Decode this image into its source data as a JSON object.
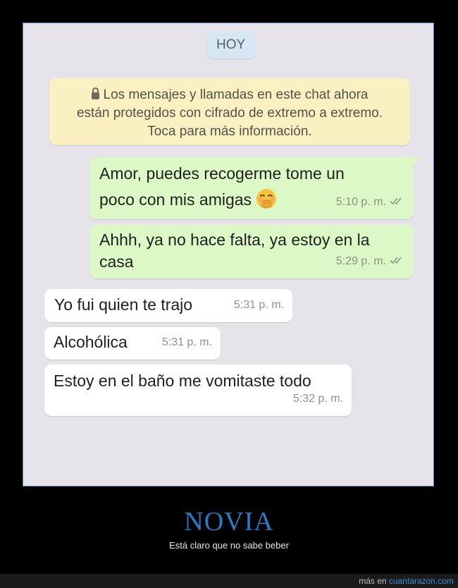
{
  "chat": {
    "date_label": "HOY",
    "encryption_notice": {
      "line1": "Los mensajes y llamadas en este chat ahora",
      "line2": "están protegidos con cifrado de extremo a extremo.",
      "line3": "Toca para más información."
    },
    "messages": [
      {
        "direction": "outgoing",
        "line1": "Amor, puedes recogerme tome un",
        "line2": "poco con mis amigas",
        "emoji": "face-with-hand-over-mouth",
        "time": "5:10 p. m.",
        "status": "read-double-check"
      },
      {
        "direction": "outgoing",
        "line1": "Ahhh, ya no hace falta, ya estoy en la",
        "line2": "casa",
        "time": "5:29 p. m.",
        "status": "read-double-check"
      },
      {
        "direction": "incoming",
        "text": "Yo fui quien te trajo",
        "time": "5:31 p. m."
      },
      {
        "direction": "incoming",
        "text": "Alcohólica",
        "time": "5:31 p. m."
      },
      {
        "direction": "incoming",
        "text": "Estoy en el baño me vomitaste todo",
        "time": "5:32 p. m."
      }
    ]
  },
  "caption": {
    "title": "NOVIA",
    "subtitle": "Está claro que no sabe beber"
  },
  "footer": {
    "prefix": "más en",
    "site": "cuantarazon.com"
  },
  "colors": {
    "outgoing_bubble": "#dcf8c6",
    "incoming_bubble": "#ffffff",
    "chat_background": "#e6e3ea",
    "notice_background": "#fbf0c2",
    "title_blue": "#2a7bc6"
  }
}
